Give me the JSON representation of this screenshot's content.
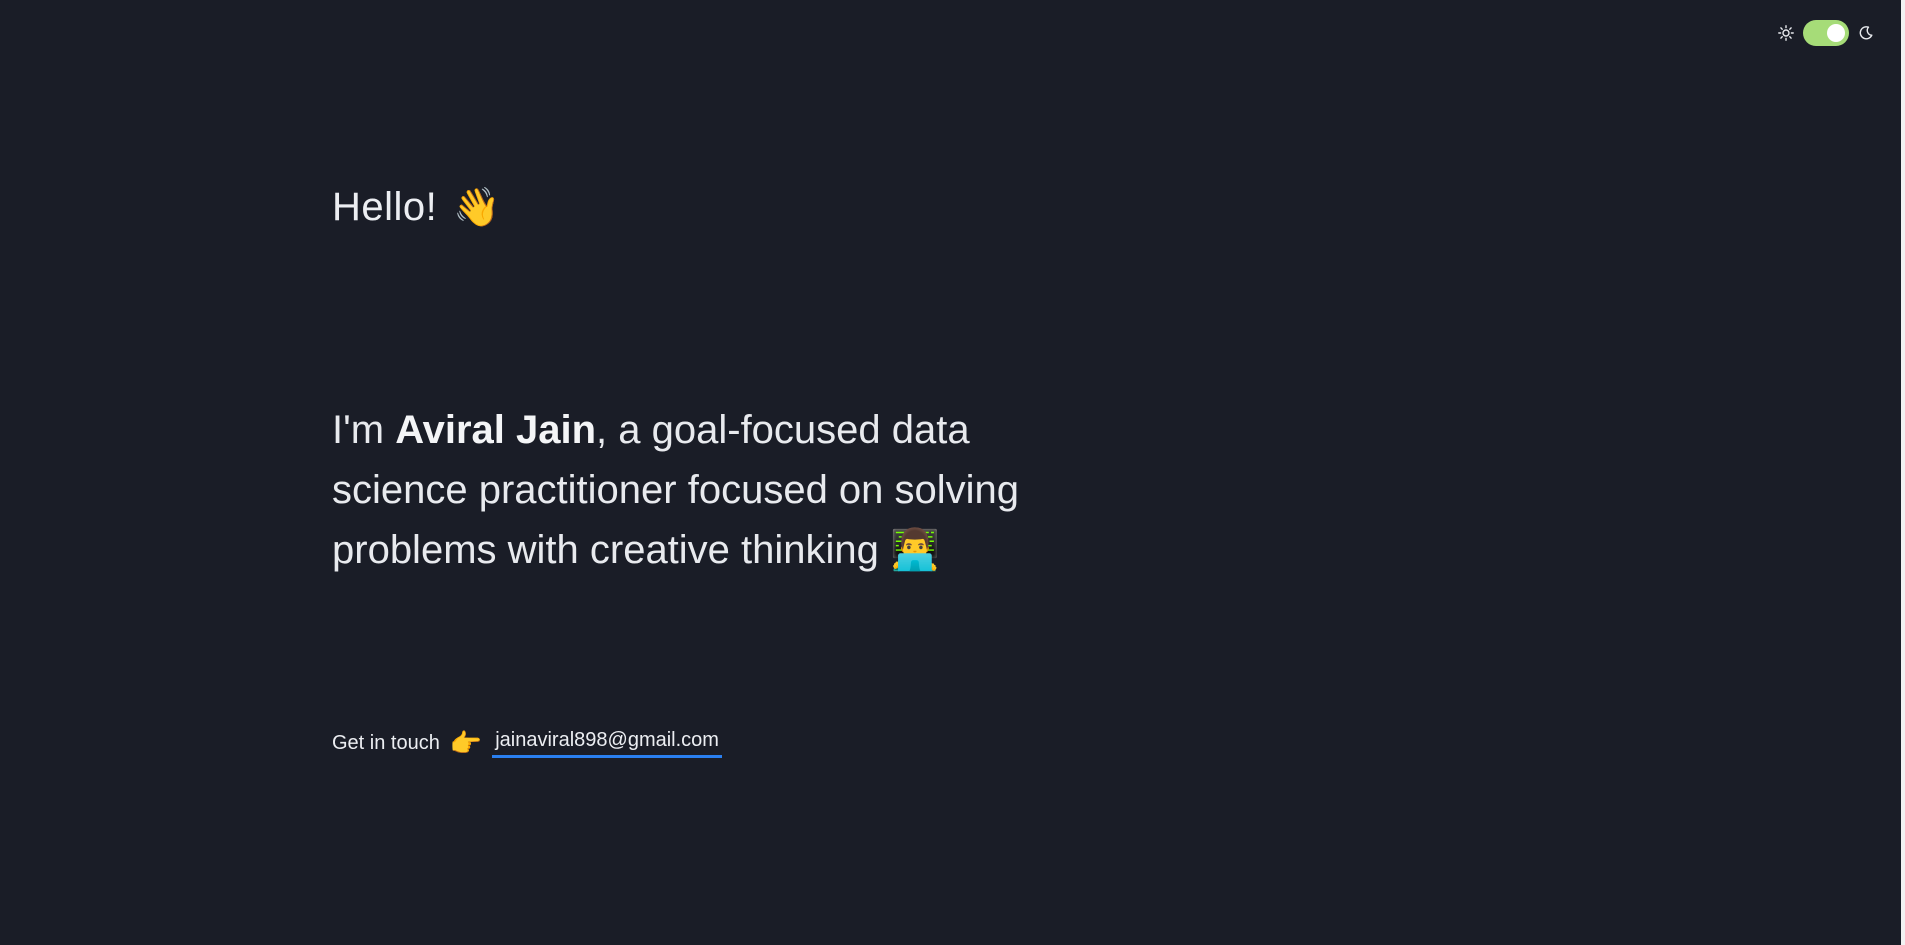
{
  "theme_switch": {
    "light_icon": "sun-icon",
    "dark_icon": "moon-icon",
    "toggle_color": "#a6dc78",
    "state": "on"
  },
  "hero": {
    "greeting": "Hello!",
    "greeting_emoji": "👋",
    "intro_prefix": "I'm ",
    "name": "Aviral Jain",
    "intro_suffix": ", a goal-focused data science practitioner focused on solving problems with creative thinking",
    "intro_emoji": "👨‍💻"
  },
  "contact": {
    "label": "Get in touch",
    "pointer_emoji": "👉",
    "email": "jainaviral898@gmail.com",
    "underline_color": "#2a7ff0"
  },
  "colors": {
    "background": "#1a1d27",
    "text": "#e8eaee"
  }
}
